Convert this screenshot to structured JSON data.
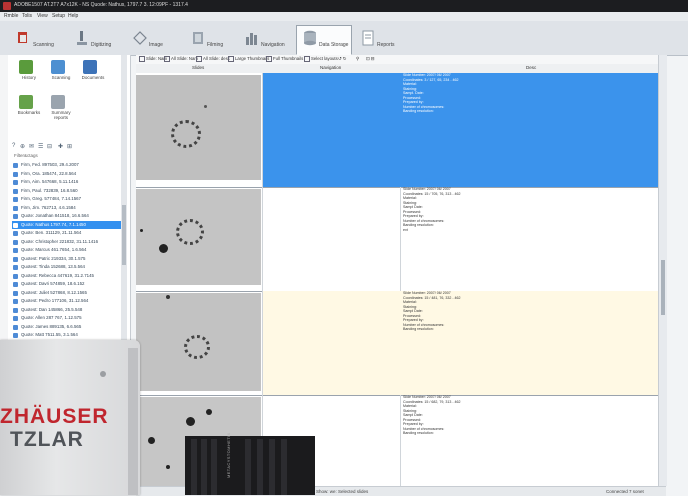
{
  "window": {
    "title": "ADOBE1507 AT.2T7 A7x12K - NS Quode: Nathus, 1797.7 3. 12:09PF - 1317.4"
  },
  "menu": [
    "Rmble",
    "Tolis",
    "View",
    "Setup",
    "Help"
  ],
  "ribbon_tabs": [
    {
      "label": "Scanning",
      "icon": "scanner-icon",
      "active": false
    },
    {
      "label": "Digitizing",
      "icon": "microscope-icon",
      "active": false
    },
    {
      "label": "Image",
      "icon": "image-icon",
      "active": false
    },
    {
      "label": "Filming",
      "icon": "film-icon",
      "active": false
    },
    {
      "label": "Navigation",
      "icon": "chart-icon",
      "active": false
    },
    {
      "label": "Data Storage",
      "icon": "database-icon",
      "active": true
    },
    {
      "label": "Reports",
      "icon": "report-icon",
      "active": false
    }
  ],
  "left_panel": {
    "buttons": [
      {
        "label": "History",
        "icon": "history-icon"
      },
      {
        "label": "Scanning",
        "icon": "scanning-icon"
      },
      {
        "label": "Documents",
        "icon": "documents-icon"
      },
      {
        "label": "Bookmarks",
        "icon": "bookmarks-icon"
      },
      {
        "label": "Summary reports",
        "icon": "summary-icon"
      }
    ],
    "tools": [
      "?",
      "⊕",
      "✉",
      "☰",
      "⊟",
      "✚",
      "⊞"
    ],
    "filter_label": "Filter&ctags",
    "items": [
      "Firm, Fed. 897503, 29.4.2007",
      "Firm, Ora. 185474, 22.8.564",
      "Firm, Aim. 547668, 5.11.1416",
      "Firm, Paul. 732839, 16.8.560",
      "Firm, Greg. 577484, 7.14.1567",
      "Firm, Jim. 762713, 4.6.1584",
      "Quote: Jonathan 841518, 16.6.564",
      "Quote: Nathus 1797.74, 7.1.1450",
      "Quote: Ben. 311129, 21.11.564",
      "Quote: Christopher 221832, 31.11.1416",
      "Quote: Marcus 461.7654, 1.6.564",
      "Quotest: Patric 219334, 30.1.575",
      "Quotest: Tinda 152688, 13.5.564",
      "Quotest: Rebecca 447619, 31.2.7145",
      "Quotest: Davri 574859, 18.6.152",
      "Quotest: Juliet 527868, 8.12.1565",
      "Quotest: Pedro 177106, 31.12.564",
      "Quotest: Dan 145866, 25.5.548",
      "Quote: Allen 287 767, 1.12.575",
      "Quote: James 889135, 6.6.565",
      "Quote: Matt 7511.55, 3.1.564"
    ],
    "selected_index": 7
  },
  "toolbar": {
    "items": [
      "Slide: Nam",
      "All Slide: Nam",
      "All Slide: desc",
      "Large Thumbnails",
      "Full Thumbnails",
      "Select layouts",
      "↺ ↻",
      "⚲",
      "⊡ ⊟"
    ]
  },
  "columns": [
    "Slides",
    "Navigation",
    "Desc"
  ],
  "rows": [
    {
      "state": "selected",
      "meta": [
        "Slide Number: 2007/ 06/ 2007",
        "Coordinates: 3 / 127, 65, 234 - 462",
        "Material:",
        "Staining:",
        "Sampl. Date:",
        "Processed:",
        "Prepared by:",
        "Number of chromosomes:",
        "Banding resolution:"
      ]
    },
    {
      "state": "normal",
      "meta": [
        "Slide Number: 2007/ 06/ 2007",
        "Coordinates: 15 / 705, 76, 313 - 462",
        "Material:",
        "Staining:",
        "Sampl Date:",
        "Processed:",
        "Prepared by:",
        "Number of chromosomes:",
        "Banding resolution:",
        "ext"
      ]
    },
    {
      "state": "highlighted",
      "meta": [
        "Slide Number: 2007/ 06/ 2007",
        "Coordinates: 15 / 481, 76, 332 - 462",
        "Material:",
        "Staining:",
        "Sampl Date:",
        "Processed:",
        "Prepared by:",
        "Number of chromosomes:",
        "Banding resolution:"
      ]
    },
    {
      "state": "normal",
      "meta": [
        "Slide Number: 2007/ 06/ 2007",
        "Coordinates: 15 / 682, 79, 313 - 462",
        "Material:",
        "Staining:",
        "Sampl Date:",
        "Processed:",
        "Prepared by:",
        "Number of chromosomes:",
        "Banding resolution:"
      ]
    }
  ],
  "status": {
    "left": "Show: we: Selected slides",
    "right": "Connected 7 sonet"
  },
  "hardware": {
    "brand_top": "ZHÄUSER",
    "brand_bottom": "TZLAR",
    "device_label": "METACYSTOMHETIX"
  },
  "colors": {
    "selection": "#3b93ec",
    "highlight": "#fff9e4",
    "brand_red": "#c0262e"
  }
}
